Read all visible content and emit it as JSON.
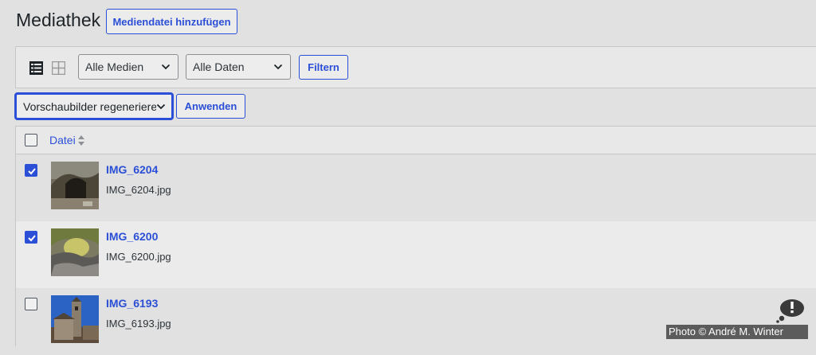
{
  "header": {
    "title": "Mediathek",
    "add_button": "Mediendatei hinzufügen"
  },
  "toolbar": {
    "view_list_icon": "list-view-icon",
    "view_grid_icon": "grid-view-icon",
    "media_filter": "Alle Medien",
    "date_filter": "Alle Daten",
    "filter_button": "Filtern"
  },
  "bulk": {
    "action": "Vorschaubilder regeneriere",
    "apply_button": "Anwenden"
  },
  "table": {
    "column": "Datei",
    "rows": [
      {
        "title": "IMG_6204",
        "file": "IMG_6204.jpg",
        "checked": true
      },
      {
        "title": "IMG_6200",
        "file": "IMG_6200.jpg",
        "checked": true
      },
      {
        "title": "IMG_6193",
        "file": "IMG_6193.jpg",
        "checked": false
      }
    ]
  },
  "credit": "Photo © André M. Winter",
  "colors": {
    "accent": "#2b4fd6",
    "background": "#e1e1e1"
  }
}
